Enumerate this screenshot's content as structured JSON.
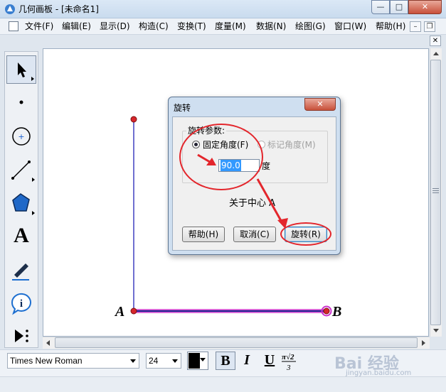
{
  "window": {
    "title": "几何画板 - [未命名1]",
    "minimize_glyph": "—",
    "maximize_glyph": "□",
    "close_glyph": "✕"
  },
  "menubar": {
    "items": [
      "文件(F)",
      "编辑(E)",
      "显示(D)",
      "构造(C)",
      "变换(T)",
      "度量(M)",
      "数据(N)",
      "绘图(G)",
      "窗口(W)",
      "帮助(H)"
    ],
    "mdi_min": "–",
    "mdi_restore": "❐",
    "mdi_close": "✕"
  },
  "toolbox": {
    "tools": [
      "arrow-select-tool",
      "point-tool",
      "compass-tool",
      "straightedge-tool",
      "polygon-tool",
      "text-tool",
      "marker-tool",
      "information-tool",
      "custom-tool"
    ],
    "text_glyph": "A"
  },
  "canvas": {
    "point_a_label": "A",
    "point_b_label": "B",
    "segment_color": "#1a1a8c",
    "vertical_color": "#6f6fd0",
    "point_color": "#d7262c",
    "selection_color": "#cc33cc"
  },
  "dialog": {
    "title": "旋转",
    "close_glyph": "✕",
    "group_label": "旋转参数:",
    "radio_fixed": "固定角度(F)",
    "radio_marked": "标记角度(M)",
    "angle_value": "90.0",
    "angle_unit": "度",
    "center_text": "关于中心 A",
    "help_button": "帮助(H)",
    "cancel_button": "取消(C)",
    "rotate_button": "旋转(R)"
  },
  "formatbar": {
    "font_name": "Times New Roman",
    "font_size": "24",
    "bold": "B",
    "italic": "I",
    "underline": "U",
    "math_format_icon": "math-format-icon"
  },
  "watermark": {
    "text": "Bai 经验",
    "sub": "jingyan.baidu.com"
  },
  "colors": {
    "annotation_red": "#e3262c",
    "accent_blue": "#3399ff"
  }
}
